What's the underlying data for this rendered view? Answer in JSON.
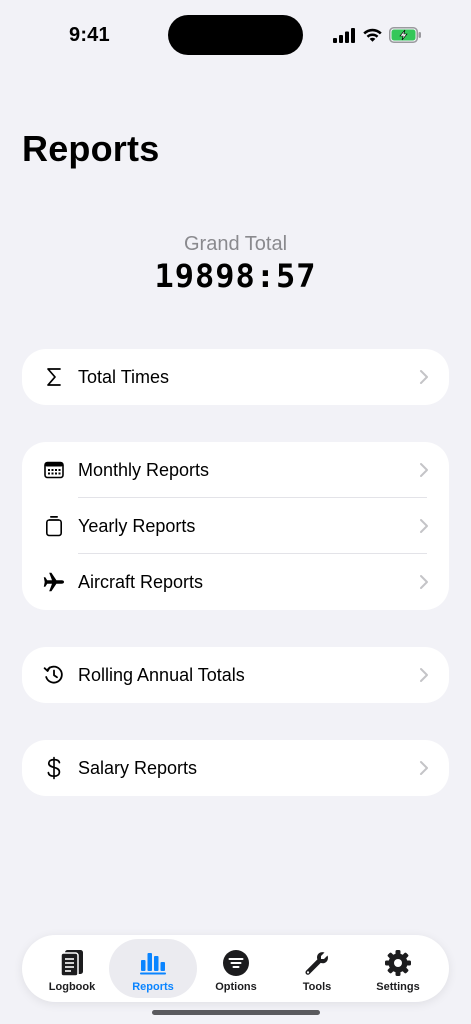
{
  "status_bar": {
    "time": "9:41",
    "icons": [
      "cellular-signal-icon",
      "wifi-icon",
      "battery-charging-icon"
    ]
  },
  "page": {
    "title": "Reports"
  },
  "grand_total": {
    "label": "Grand Total",
    "value": "19898:57"
  },
  "groups": [
    {
      "items": [
        {
          "icon": "sigma-icon",
          "label": "Total Times"
        }
      ]
    },
    {
      "items": [
        {
          "icon": "calendar-icon",
          "label": "Monthly Reports"
        },
        {
          "icon": "cylinder-icon",
          "label": "Yearly Reports"
        },
        {
          "icon": "airplane-icon",
          "label": "Aircraft Reports"
        }
      ]
    },
    {
      "items": [
        {
          "icon": "history-clock-icon",
          "label": "Rolling Annual Totals"
        }
      ]
    },
    {
      "items": [
        {
          "icon": "dollar-sign-icon",
          "label": "Salary Reports"
        }
      ]
    }
  ],
  "tab_bar": {
    "active": "Reports",
    "tabs": [
      {
        "label": "Logbook",
        "icon": "logbook-icon"
      },
      {
        "label": "Reports",
        "icon": "bar-chart-icon"
      },
      {
        "label": "Options",
        "icon": "options-filter-icon"
      },
      {
        "label": "Tools",
        "icon": "wrench-icon"
      },
      {
        "label": "Settings",
        "icon": "gear-icon"
      }
    ]
  },
  "colors": {
    "background": "#f2f2f7",
    "card": "#ffffff",
    "accent": "#0a84ff",
    "secondary_text": "#8a8a8e",
    "chevron": "#c4c4c7",
    "battery": "#34c759"
  }
}
